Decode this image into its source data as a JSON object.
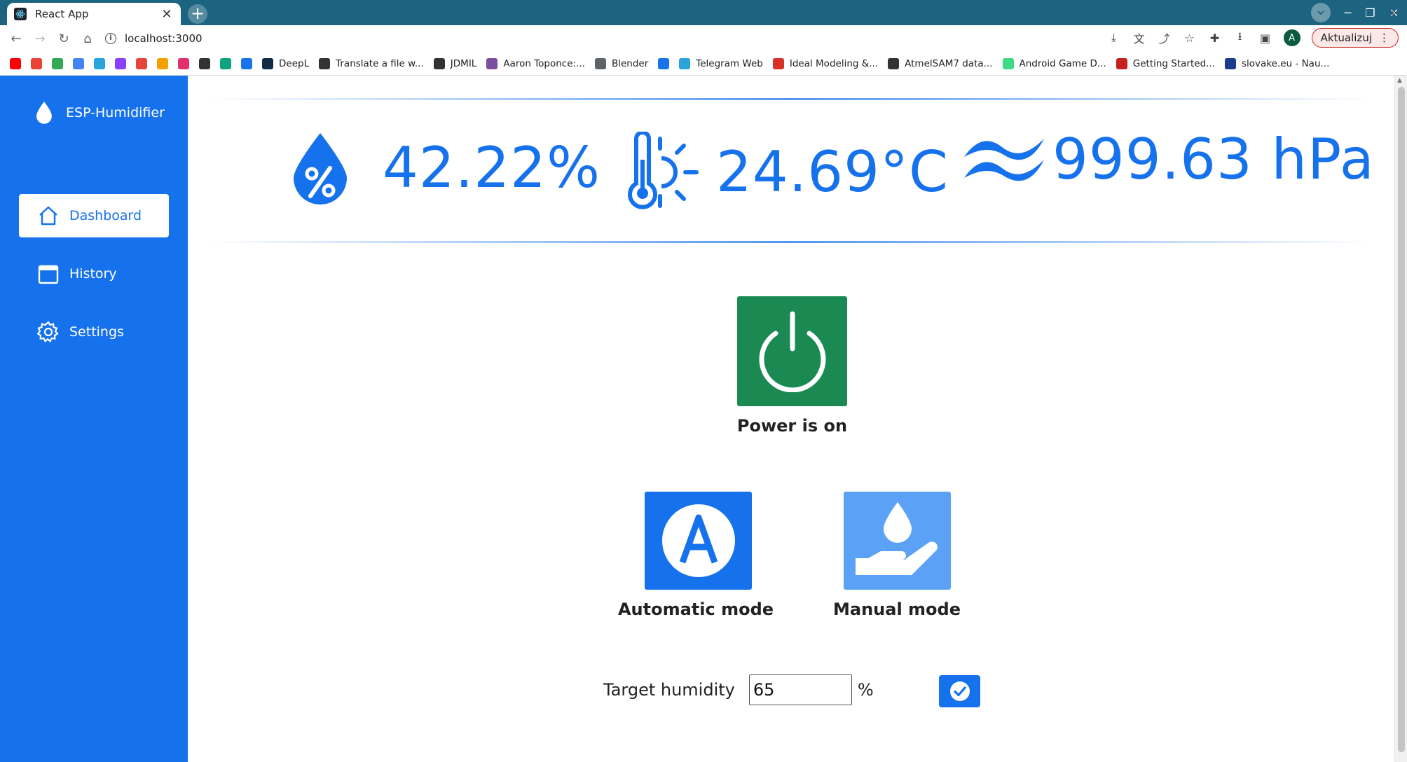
{
  "browser": {
    "tab_title": "React App",
    "tab_close": "✕",
    "new_tab": "+",
    "url": "localhost:3000",
    "update_label": "Aktualizuj",
    "profile_initial": "A",
    "bookmarks": [
      {
        "label": "",
        "icon": "youtube-icon",
        "color": "#ff0000"
      },
      {
        "label": "",
        "icon": "gmail-icon",
        "color": "#ea4335"
      },
      {
        "label": "",
        "icon": "drive-icon",
        "color": "#34a853"
      },
      {
        "label": "",
        "icon": "translate-icon",
        "color": "#4285f4"
      },
      {
        "label": "",
        "icon": "telegram-icon",
        "color": "#2aa3df"
      },
      {
        "label": "",
        "icon": "messenger-icon",
        "color": "#8a3ffc"
      },
      {
        "label": "",
        "icon": "app-icon",
        "color": "#e8453c"
      },
      {
        "label": "",
        "icon": "app-icon",
        "color": "#f4a000"
      },
      {
        "label": "",
        "icon": "instagram-icon",
        "color": "#e1306c"
      },
      {
        "label": "",
        "icon": "globe-icon",
        "color": "#333333"
      },
      {
        "label": "",
        "icon": "chatgpt-icon",
        "color": "#10a37f"
      },
      {
        "label": "",
        "icon": "app-icon",
        "color": "#1a73e8"
      },
      {
        "label": "DeepL",
        "icon": "deepl-icon",
        "color": "#0f2b46"
      },
      {
        "label": "Translate a file w...",
        "icon": "globe-icon",
        "color": "#333333"
      },
      {
        "label": "JDMIL",
        "icon": "globe-icon",
        "color": "#333333"
      },
      {
        "label": "Aaron Toponce:...",
        "icon": "app-icon",
        "color": "#7b4ea0"
      },
      {
        "label": "Blender",
        "icon": "folder-icon",
        "color": "#5f6368"
      },
      {
        "label": "",
        "icon": "app-icon",
        "color": "#1a73e8"
      },
      {
        "label": "Telegram Web",
        "icon": "telegram-icon",
        "color": "#2aa3df"
      },
      {
        "label": "Ideal Modeling &...",
        "icon": "app-icon",
        "color": "#d93025"
      },
      {
        "label": "AtmelSAM7 data...",
        "icon": "globe-icon",
        "color": "#333333"
      },
      {
        "label": "Android Game D...",
        "icon": "android-icon",
        "color": "#3ddc84"
      },
      {
        "label": "Getting Started...",
        "icon": "app-icon",
        "color": "#c5221f"
      },
      {
        "label": "slovake.eu - Nau...",
        "icon": "app-icon",
        "color": "#1a3c8f"
      }
    ],
    "bookmarks_more": "»"
  },
  "app": {
    "brand": "ESP-Humidifier",
    "nav": [
      {
        "label": "Dashboard",
        "icon": "home-icon",
        "active": true
      },
      {
        "label": "History",
        "icon": "calendar-icon",
        "active": false
      },
      {
        "label": "Settings",
        "icon": "gear-icon",
        "active": false
      }
    ],
    "readings": {
      "humidity": "42.22%",
      "temperature": "24.69°C",
      "pressure": "999.63 hPa"
    },
    "power": {
      "label": "Power is on",
      "on": true
    },
    "modes": {
      "automatic": "Automatic mode",
      "manual": "Manual mode",
      "selected": "automatic"
    },
    "target": {
      "label": "Target humidity",
      "value": "65",
      "unit": "%"
    },
    "colors": {
      "primary": "#1672ec",
      "power_on": "#1a8a52",
      "mode_inactive": "#5ba1f5"
    }
  }
}
